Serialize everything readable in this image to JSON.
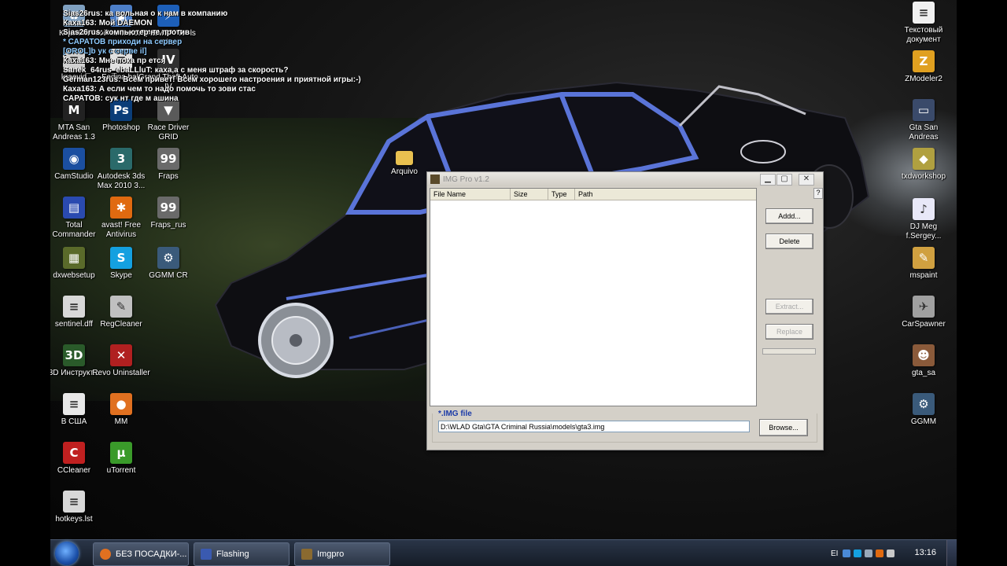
{
  "chat": [
    {
      "text": "Sias26rus: ка     вольная     о к нам в компанию",
      "color": "white"
    },
    {
      "text": "Каха163:         Мой        DAEMON",
      "color": "white"
    },
    {
      "text": "Sias26rus:   компьютер  не против",
      "color": "white"
    },
    {
      "text": "* САРАТОВ приходи на сервер",
      "color": "blue"
    },
    {
      "text": "[OROL]b ук     с серве      il]",
      "color": "blue"
    },
    {
      "text": "Каха163: Мне      пока пр      ется",
      "color": "white"
    },
    {
      "text": "Sanek_64rus_ebaLLluT: каха,а с меня штраф за скорость?",
      "color": "white"
    },
    {
      "text": "German123rus: Всем привет! Всем хорошего настроения и приятной игры:-)",
      "color": "white"
    },
    {
      "text": "Каха163: А если чем то надо помочь то зови стас",
      "color": "white"
    },
    {
      "text": "САРАТОВ: сук    нт где м     ашина",
      "color": "white"
    }
  ],
  "desktop_icons": {
    "left": [
      {
        "label": "Корзина",
        "icon": "recycle-bin-icon",
        "color": "#7fa0c0",
        "glyph": "♻"
      },
      {
        "label": "Мой компьютер",
        "icon": "my-computer-icon",
        "color": "#4d7fc8",
        "glyph": "▣"
      },
      {
        "label": "DAEMON Tools Lite",
        "icon": "daemon-tools-icon",
        "color": "#1d5fb8",
        "glyph": "⚡"
      },
      {
        "label": "kraevid",
        "icon": "file-icon",
        "color": "#cfcfcf",
        "glyph": "≡"
      },
      {
        "label": "Fedina.bak",
        "icon": "file-icon",
        "color": "#e0e0e0",
        "glyph": "≡"
      },
      {
        "label": "Grand Theft Auto IV",
        "icon": "gta4-icon",
        "color": "#303030",
        "glyph": "IV"
      },
      {
        "label": "MTA San Andreas 1.3",
        "icon": "mta-icon",
        "color": "#222222",
        "glyph": "M"
      },
      {
        "label": "Photoshop",
        "icon": "photoshop-icon",
        "color": "#0b3d78",
        "glyph": "Ps"
      },
      {
        "label": "Race Driver GRID",
        "icon": "grid-game-icon",
        "color": "#5a5a5a",
        "glyph": "▼"
      },
      {
        "label": "CamStudio",
        "icon": "camstudio-icon",
        "color": "#1b4fa0",
        "glyph": "◉"
      },
      {
        "label": "Autodesk 3ds Max 2010 3...",
        "icon": "3dsmax-icon",
        "color": "#2a6a6a",
        "glyph": "3"
      },
      {
        "label": "Fraps",
        "icon": "fraps-icon",
        "color": "#6a6a6a",
        "glyph": "99"
      },
      {
        "label": "Total Commander",
        "icon": "total-commander-icon",
        "color": "#2a4ab0",
        "glyph": "▤"
      },
      {
        "label": "avast! Free Antivirus",
        "icon": "avast-icon",
        "color": "#e06a10",
        "glyph": "✱"
      },
      {
        "label": "Fraps_rus",
        "icon": "fraps-icon",
        "color": "#6a6a6a",
        "glyph": "99"
      },
      {
        "label": "dxwebsetup",
        "icon": "dxwebsetup-icon",
        "color": "#5a6a2a",
        "glyph": "▦"
      },
      {
        "label": "Skype",
        "icon": "skype-icon",
        "color": "#14a0e0",
        "glyph": "S"
      },
      {
        "label": "GGMM CR",
        "icon": "ggmm-icon",
        "color": "#3a5a7a",
        "glyph": "⚙"
      },
      {
        "label": "sentinel.dff",
        "icon": "file-icon",
        "color": "#d8d8d8",
        "glyph": "≡"
      },
      {
        "label": "RegCleaner",
        "icon": "regcleaner-icon",
        "color": "#c0c0c0",
        "glyph": "✎"
      },
      {
        "label": "3D Инструкт...",
        "icon": "3d-instructor-icon",
        "color": "#2a5a2a",
        "glyph": "3D"
      },
      {
        "label": "Revo Uninstaller",
        "icon": "revo-icon",
        "color": "#b02020",
        "glyph": "✕"
      },
      {
        "label": "В США",
        "icon": "text-file-icon",
        "color": "#e8e8e8",
        "glyph": "≡"
      },
      {
        "label": "MM",
        "icon": "firefox-icon",
        "color": "#e07020",
        "glyph": "●"
      },
      {
        "label": "CCleaner",
        "icon": "ccleaner-icon",
        "color": "#c02020",
        "glyph": "C"
      },
      {
        "label": "uTorrent",
        "icon": "utorrent-icon",
        "color": "#3a9a2a",
        "glyph": "µ"
      },
      {
        "label": "hotkeys.lst",
        "icon": "file-icon",
        "color": "#d8d8d8",
        "glyph": "≡"
      }
    ],
    "arquivo": {
      "label": "Arquivo",
      "icon": "folder-icon",
      "color": "#e8c050",
      "glyph": "▬"
    },
    "right": [
      {
        "label": "Текстовый документ",
        "icon": "text-document-icon",
        "color": "#f0f0f0",
        "glyph": "≡"
      },
      {
        "label": "ZModeler2",
        "icon": "zmodeler-icon",
        "color": "#e0a020",
        "glyph": "Z"
      },
      {
        "label": "Gta San Andreas",
        "icon": "gta-sa-icon",
        "color": "#3a4a6a",
        "glyph": "▭"
      },
      {
        "label": "txdworkshop",
        "icon": "txdworkshop-icon",
        "color": "#b0a040",
        "glyph": "◆"
      },
      {
        "label": "DJ Meg f.Sergey...",
        "icon": "mp3-icon",
        "color": "#e8e8f8",
        "glyph": "♪"
      },
      {
        "label": "mspaint",
        "icon": "mspaint-icon",
        "color": "#d0a040",
        "glyph": "✎"
      },
      {
        "label": "CarSpawner",
        "icon": "carspawner-icon",
        "color": "#a0a0a0",
        "glyph": "✈"
      },
      {
        "label": "gta_sa",
        "icon": "gta-sa-exe-icon",
        "color": "#8a5a3a",
        "glyph": "☻"
      },
      {
        "label": "GGMM",
        "icon": "ggmm-icon",
        "color": "#3a5a7a",
        "glyph": "⚙"
      }
    ]
  },
  "window": {
    "title": "IMG Pro v1.2",
    "columns": [
      "File Name",
      "Size",
      "Type",
      "Path"
    ],
    "help_label": "?",
    "buttons": {
      "add": "Addd...",
      "delete": "Delete",
      "extract": "Extract...",
      "replace": "Replace"
    },
    "img_file_label": "*.IMG file",
    "img_path_value": "D:\\WLAD Gta\\GTA Criminal Russia\\models\\gta3.img",
    "browse": "Browse..."
  },
  "taskbar": {
    "tasks": [
      {
        "label": "БЕЗ ПОСАДКИ-...",
        "icon": "firefox-icon",
        "color": "#e07020"
      },
      {
        "label": "Flashing",
        "icon": "flashing-window-icon",
        "color": "#3a5ab0"
      },
      {
        "label": "Imgpro",
        "icon": "imgpro-icon",
        "color": "#8a6a30"
      }
    ],
    "language": "EI",
    "clock": "13:16"
  }
}
